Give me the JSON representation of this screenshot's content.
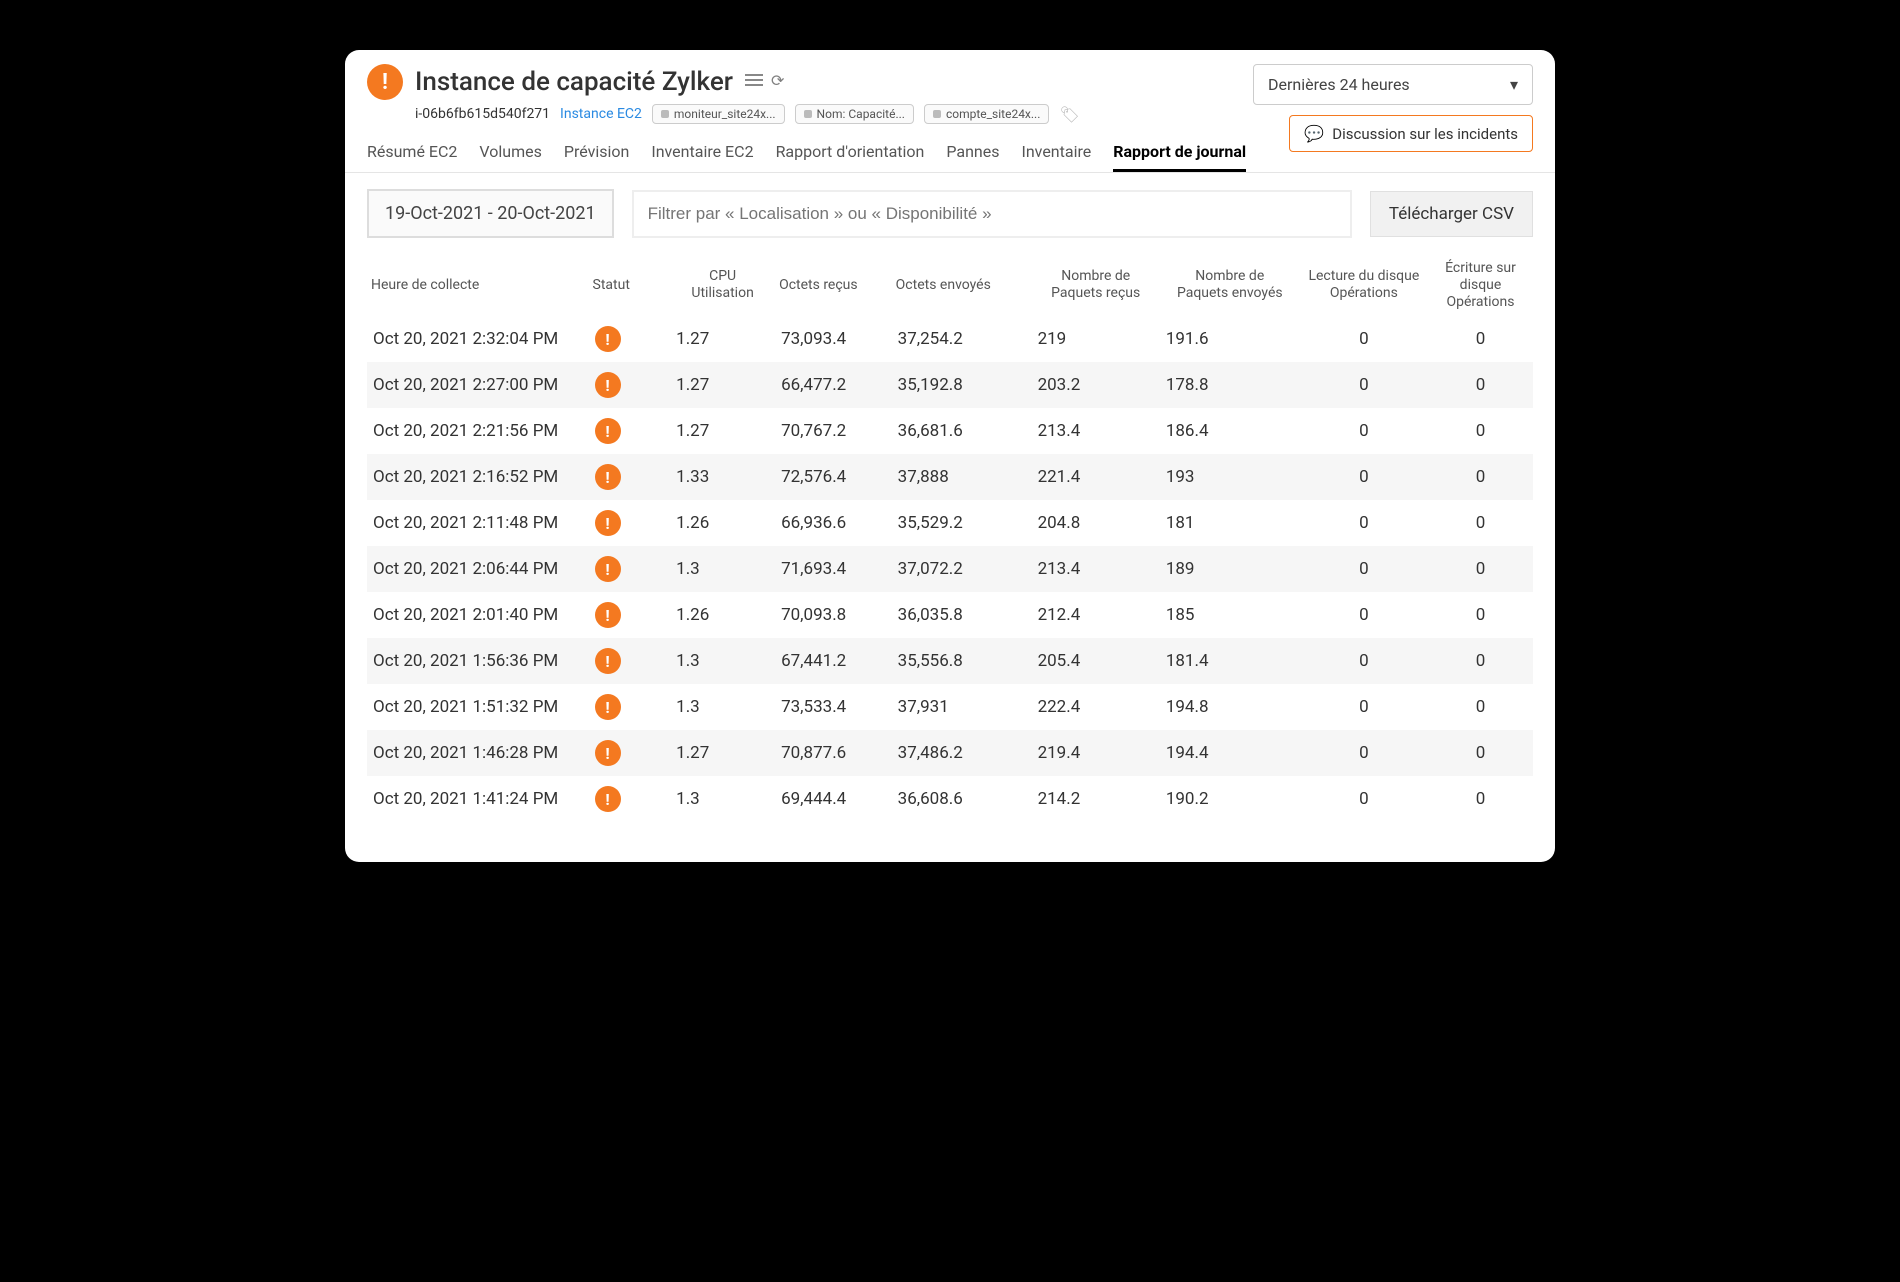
{
  "title": "Instance de capacité Zylker",
  "instance_id": "i-06b6fb615d540f271",
  "instance_type": "Instance EC2",
  "tags": [
    "moniteur_site24x...",
    "Nom: Capacité...",
    "compte_site24x..."
  ],
  "range_label": "Dernières 24 heures",
  "discuss_label": "Discussion sur les incidents",
  "tabs": [
    "Résumé EC2",
    "Volumes",
    "Prévision",
    "Inventaire EC2",
    "Rapport d'orientation",
    "Pannes",
    "Inventaire",
    "Rapport de journal"
  ],
  "active_tab": 7,
  "date_range": "19-Oct-2021 - 20-Oct-2021",
  "filter_placeholder": "Filtrer par « Localisation » ou « Disponibilité »",
  "csv_label": "Télécharger CSV",
  "columns": {
    "time": "Heure de collecte",
    "status": "Statut",
    "cpu1": "CPU",
    "cpu2": "Utilisation",
    "brx": "Octets reçus",
    "btx": "Octets envoyés",
    "prx1": "Nombre de",
    "prx2": "Paquets reçus",
    "ptx1": "Nombre de",
    "ptx2": "Paquets envoyés",
    "dr1": "Lecture du disque",
    "dr2": "Opérations",
    "dw1": "Écriture sur",
    "dw2": "disque",
    "dw3": "Opérations"
  },
  "rows": [
    {
      "t": "Oct 20, 2021 2:32:04 PM",
      "cpu": "1.27",
      "brx": "73,093.4",
      "btx": "37,254.2",
      "prx": "219",
      "ptx": "191.6",
      "dr": "0",
      "dw": "0"
    },
    {
      "t": "Oct 20, 2021 2:27:00 PM",
      "cpu": "1.27",
      "brx": "66,477.2",
      "btx": "35,192.8",
      "prx": "203.2",
      "ptx": "178.8",
      "dr": "0",
      "dw": "0"
    },
    {
      "t": "Oct 20, 2021 2:21:56 PM",
      "cpu": "1.27",
      "brx": "70,767.2",
      "btx": "36,681.6",
      "prx": "213.4",
      "ptx": "186.4",
      "dr": "0",
      "dw": "0"
    },
    {
      "t": "Oct 20, 2021 2:16:52 PM",
      "cpu": "1.33",
      "brx": "72,576.4",
      "btx": "37,888",
      "prx": "221.4",
      "ptx": "193",
      "dr": "0",
      "dw": "0"
    },
    {
      "t": "Oct 20, 2021 2:11:48 PM",
      "cpu": "1.26",
      "brx": "66,936.6",
      "btx": "35,529.2",
      "prx": "204.8",
      "ptx": "181",
      "dr": "0",
      "dw": "0"
    },
    {
      "t": "Oct 20, 2021 2:06:44 PM",
      "cpu": "1.3",
      "brx": "71,693.4",
      "btx": "37,072.2",
      "prx": "213.4",
      "ptx": "189",
      "dr": "0",
      "dw": "0"
    },
    {
      "t": "Oct 20, 2021 2:01:40 PM",
      "cpu": "1.26",
      "brx": "70,093.8",
      "btx": "36,035.8",
      "prx": "212.4",
      "ptx": "185",
      "dr": "0",
      "dw": "0"
    },
    {
      "t": "Oct 20, 2021 1:56:36 PM",
      "cpu": "1.3",
      "brx": "67,441.2",
      "btx": "35,556.8",
      "prx": "205.4",
      "ptx": "181.4",
      "dr": "0",
      "dw": "0"
    },
    {
      "t": "Oct 20, 2021 1:51:32 PM",
      "cpu": "1.3",
      "brx": "73,533.4",
      "btx": "37,931",
      "prx": "222.4",
      "ptx": "194.8",
      "dr": "0",
      "dw": "0"
    },
    {
      "t": "Oct 20, 2021 1:46:28 PM",
      "cpu": "1.27",
      "brx": "70,877.6",
      "btx": "37,486.2",
      "prx": "219.4",
      "ptx": "194.4",
      "dr": "0",
      "dw": "0"
    },
    {
      "t": "Oct 20, 2021 1:41:24 PM",
      "cpu": "1.3",
      "brx": "69,444.4",
      "btx": "36,608.6",
      "prx": "214.2",
      "ptx": "190.2",
      "dr": "0",
      "dw": "0"
    }
  ]
}
